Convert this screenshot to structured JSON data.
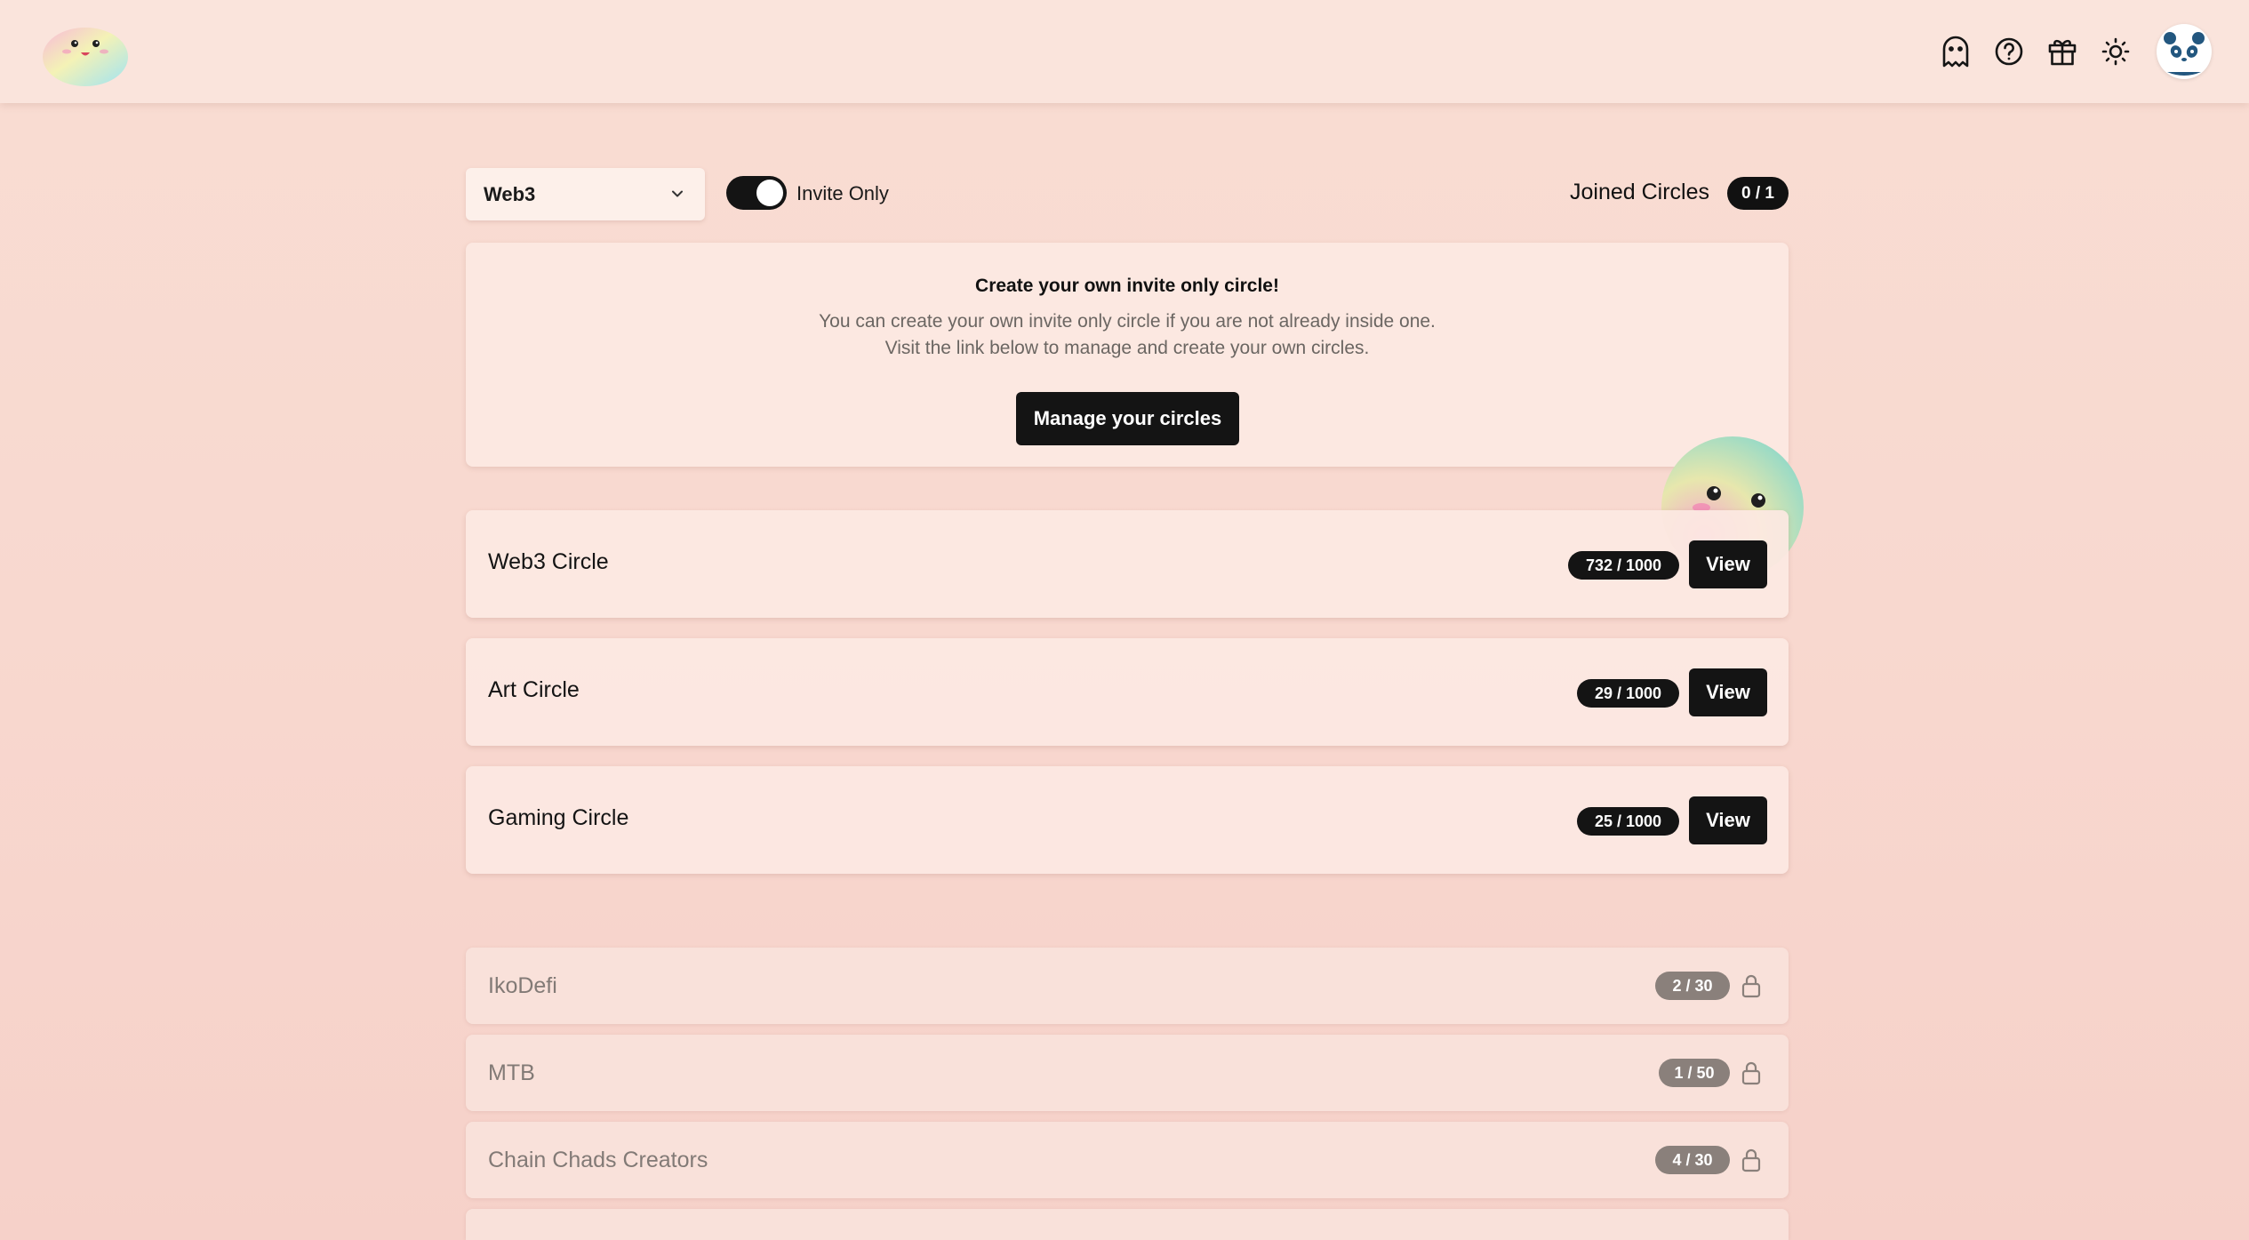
{
  "header": {
    "logo_icon": "blob-mascot-logo",
    "icons": [
      "ghost-icon",
      "help-icon",
      "gift-icon",
      "sun-icon"
    ],
    "avatar_icon": "panda-avatar"
  },
  "toolbar": {
    "category_select": {
      "value": "Web3"
    },
    "invite_toggle": {
      "label": "Invite Only",
      "on": true
    },
    "joined": {
      "label": "Joined Circles",
      "count": "0 / 1"
    }
  },
  "create_card": {
    "title": "Create your own invite only circle!",
    "line1": "You can create your own invite only circle if you are not already inside one.",
    "line2": "Visit the link below to manage and create your own circles.",
    "button": "Manage your circles"
  },
  "circles": [
    {
      "name": "Web3 Circle",
      "count": "732 / 1000",
      "button": "View"
    },
    {
      "name": "Art Circle",
      "count": "29 / 1000",
      "button": "View"
    },
    {
      "name": "Gaming Circle",
      "count": "25 / 1000",
      "button": "View"
    }
  ],
  "locked_circles": [
    {
      "name": "IkoDefi",
      "count": "2 / 30"
    },
    {
      "name": "MTB",
      "count": "1 / 50"
    },
    {
      "name": "Chain Chads Creators",
      "count": "4 / 30"
    }
  ],
  "colors": {
    "accent": "#141414",
    "background": "#f9ddd3",
    "card": "#fce8e1",
    "locked_text": "#827a76"
  }
}
